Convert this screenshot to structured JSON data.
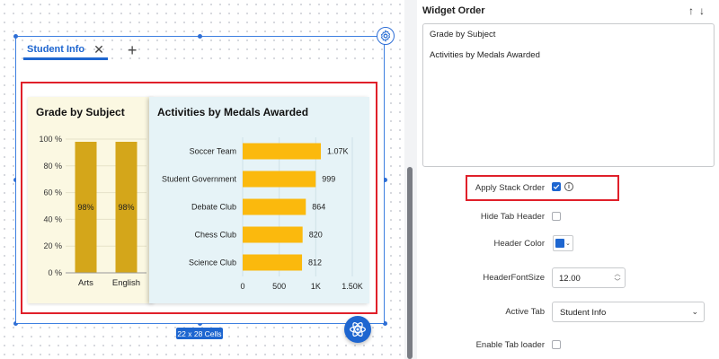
{
  "canvas": {
    "tab": {
      "label": "Student Info"
    },
    "size_badge": "22 x 28 Cells"
  },
  "grade_chart": {
    "title": "Grade by Subject",
    "chart_data": {
      "type": "bar",
      "categories": [
        "Arts",
        "English"
      ],
      "values": [
        98,
        98
      ],
      "data_labels": [
        "98%",
        "98%"
      ],
      "yticks": [
        "0 %",
        "20 %",
        "40 %",
        "60 %",
        "80 %",
        "100 %"
      ],
      "ylim": [
        0,
        100
      ],
      "color": "#d4a61a"
    }
  },
  "activities_chart": {
    "title": "Activities by Medals Awarded",
    "chart_data": {
      "type": "bar",
      "orientation": "horizontal",
      "categories": [
        "Soccer Team",
        "Student Government",
        "Debate Club",
        "Chess Club",
        "Science Club"
      ],
      "values": [
        1070,
        999,
        864,
        820,
        812
      ],
      "data_labels": [
        "1.07K",
        "999",
        "864",
        "820",
        "812"
      ],
      "xticks": [
        "0",
        "500",
        "1K",
        "1.50K"
      ],
      "xlim": [
        0,
        1500
      ],
      "color": "#fbb90d"
    }
  },
  "panel": {
    "title": "Widget Order",
    "order_items": [
      "Grade by Subject",
      "Activities by Medals Awarded"
    ],
    "apply_stack_order": {
      "label": "Apply Stack Order",
      "checked": true
    },
    "hide_tab_header": {
      "label": "Hide Tab Header",
      "checked": false
    },
    "header_color": {
      "label": "Header Color",
      "value": "#1e66d0"
    },
    "header_font_size": {
      "label": "HeaderFontSize",
      "value": "12.00"
    },
    "active_tab": {
      "label": "Active Tab",
      "value": "Student Info"
    },
    "enable_tab_loader": {
      "label": "Enable Tab loader",
      "checked": false
    }
  },
  "colors": {
    "accent": "#1e66d0",
    "highlight_border": "#e0202a"
  }
}
